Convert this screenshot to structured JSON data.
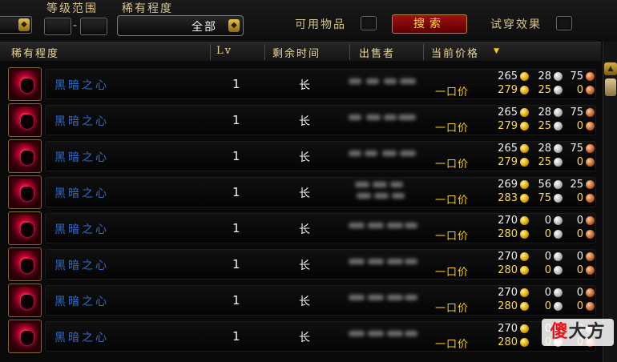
{
  "filters": {
    "level_range_label": "等级范围",
    "level_dash": "-",
    "rarity_label": "稀有程度",
    "rarity_value": "全部",
    "usable_label": "可用物品",
    "search_button": "搜索",
    "try_on_label": "试穿效果"
  },
  "headers": {
    "rarity": "稀有程度",
    "lv": "Lv",
    "time": "剩余时间",
    "seller": "出售者",
    "price": "当前价格",
    "sort_arrow": "▼"
  },
  "buyout_label": "一口价",
  "rows": [
    {
      "name": "黑暗之心",
      "lv": "1",
      "time": "长",
      "bid": {
        "g": "265",
        "s": "28",
        "c": "75"
      },
      "buyout": {
        "g": "279",
        "s": "25",
        "c": "0"
      }
    },
    {
      "name": "黑暗之心",
      "lv": "1",
      "time": "长",
      "bid": {
        "g": "265",
        "s": "28",
        "c": "75"
      },
      "buyout": {
        "g": "279",
        "s": "25",
        "c": "0"
      }
    },
    {
      "name": "黑暗之心",
      "lv": "1",
      "time": "长",
      "bid": {
        "g": "265",
        "s": "28",
        "c": "75"
      },
      "buyout": {
        "g": "279",
        "s": "25",
        "c": "0"
      }
    },
    {
      "name": "黑暗之心",
      "lv": "1",
      "time": "长",
      "bid": {
        "g": "269",
        "s": "56",
        "c": "25"
      },
      "buyout": {
        "g": "283",
        "s": "75",
        "c": "0"
      }
    },
    {
      "name": "黑暗之心",
      "lv": "1",
      "time": "长",
      "bid": {
        "g": "270",
        "s": "0",
        "c": "0"
      },
      "buyout": {
        "g": "280",
        "s": "0",
        "c": "0"
      }
    },
    {
      "name": "黑暗之心",
      "lv": "1",
      "time": "长",
      "bid": {
        "g": "270",
        "s": "0",
        "c": "0"
      },
      "buyout": {
        "g": "280",
        "s": "0",
        "c": "0"
      }
    },
    {
      "name": "黑暗之心",
      "lv": "1",
      "time": "长",
      "bid": {
        "g": "270",
        "s": "0",
        "c": "0"
      },
      "buyout": {
        "g": "280",
        "s": "0",
        "c": "0"
      }
    },
    {
      "name": "黑暗之心",
      "lv": "1",
      "time": "长",
      "bid": {
        "g": "270",
        "s": "0",
        "c": "0"
      },
      "buyout": {
        "g": "280",
        "s": "0",
        "c": "0"
      }
    }
  ],
  "watermark": {
    "part1": "傻",
    "part2": "大方"
  },
  "colors": {
    "item_name": "#2f6cc8",
    "buyout": "#ffd000",
    "header": "#e8d59a"
  }
}
